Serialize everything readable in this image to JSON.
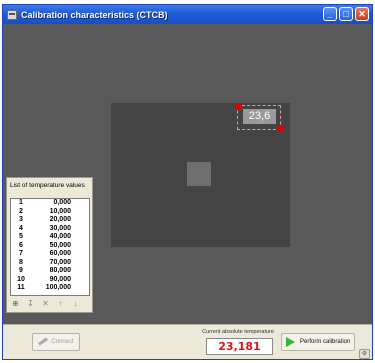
{
  "window": {
    "title": "Calibration characteristics (CTCB)",
    "accent_color": "#1f5bd6",
    "buttons": {
      "minimize": "_",
      "maximize": "□",
      "close": "✕"
    }
  },
  "view": {
    "roi_value": "23,6",
    "roi_color": "#e00000"
  },
  "temperature_panel": {
    "title": "List of temperature values",
    "rows": [
      {
        "index": "1",
        "value": "0,000"
      },
      {
        "index": "2",
        "value": "10,000"
      },
      {
        "index": "3",
        "value": "20,000"
      },
      {
        "index": "4",
        "value": "30,000"
      },
      {
        "index": "5",
        "value": "40,000"
      },
      {
        "index": "6",
        "value": "50,000"
      },
      {
        "index": "7",
        "value": "60,000"
      },
      {
        "index": "8",
        "value": "70,000"
      },
      {
        "index": "9",
        "value": "80,000"
      },
      {
        "index": "10",
        "value": "90,000"
      },
      {
        "index": "11",
        "value": "100,000"
      }
    ],
    "tools": [
      "add-icon",
      "insert-icon",
      "delete-icon",
      "move-up-icon",
      "move-down-icon"
    ]
  },
  "bottom": {
    "connect_label": "Connect",
    "absolute_temp_label": "Current absolute temperature",
    "absolute_temp_value": "23,181",
    "value_color": "#e0141a",
    "perform_label": "Perform calibration"
  }
}
